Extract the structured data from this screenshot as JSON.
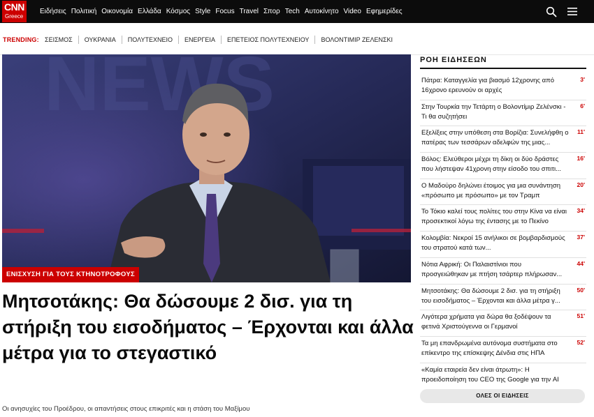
{
  "brand": {
    "logo_text": "CNN",
    "logo_sub": "Greece",
    "accent": "#cc0000",
    "nav_bg": "#0c0c0c"
  },
  "nav": {
    "links": [
      "Ειδήσεις",
      "Πολιτική",
      "Οικονομία",
      "Ελλάδα",
      "Κόσμος",
      "Style",
      "Focus",
      "Travel",
      "Σπορ",
      "Tech",
      "Αυτοκίνητο",
      "Video",
      "Εφημερίδες"
    ],
    "icons": [
      "search-icon",
      "menu-icon"
    ]
  },
  "trending": {
    "label": "TRENDING:",
    "items": [
      "ΣΕΙΣΜΟΣ",
      "ΟΥΚΡΑΝΙΑ",
      "ΠΟΛΥΤΕΧΝΕΙΟ",
      "ΕΝΕΡΓΕΙΑ",
      "ΕΠΕΤΕΙΟΣ ΠΟΛΥΤΕΧΝΕΙΟΥ",
      "ΒΟΛΟΝΤΙΜΙΡ ΖΕΛΕΝΣΚΙ"
    ]
  },
  "hero": {
    "tag": "ΕΝΙΣΧΥΣΗ ΓΙΑ ΤΟΥΣ ΚΤΗΝΟΤΡΟΦΟΥΣ",
    "headline": "Μητσοτάκης: Θα δώσουμε 2 δισ. για τη στήριξη του εισοδήματος – Έρχονται και άλλα μέτρα για το στεγαστικό",
    "subhead": "Οι ανησυχίες του Προέδρου, οι απαντήσεις στους επικριτές και η στάση του Μαξίμου"
  },
  "ticker": {
    "title": "ΡΟΗ ΕΙΔΗΣΕΩΝ",
    "items": [
      {
        "text": "Πάτρα: Καταγγελία για βιασμό 12χρονης από 16χρονο ερευνούν οι αρχές",
        "time": "3'"
      },
      {
        "text": "Στην Τουρκία την Τετάρτη ο Βολοντίμιρ Ζελένσκι - Τι θα συζητήσει",
        "time": "6'"
      },
      {
        "text": "Εξελίξεις στην υπόθεση στα Βορίζια: Συνελήφθη ο πατέρας των τεσσάρων αδελφών της μιας...",
        "time": "11'"
      },
      {
        "text": "Βόλος: Ελεύθεροι μέχρι τη δίκη οι δύο δράστες που λήστεψαν 41χρονη στην είσοδο του σπιτι...",
        "time": "16'"
      },
      {
        "text": "Ο Μαδούρο δηλώνει έτοιμος για μια συνάντηση «πρόσωπο με πρόσωπο» με τον Τραμπ",
        "time": "20'"
      },
      {
        "text": "Το Τόκιο καλεί τους πολίτες του στην Κίνα να είναι προσεκτικοί λόγω της έντασης με το Πεκίνο",
        "time": "34'"
      },
      {
        "text": "Κολομβία: Νεκροί 15 ανήλικοι σε βομβαρδισμούς του στρατού κατά των...",
        "time": "37'"
      },
      {
        "text": "Νότια Αφρική: Οι Παλαιστίνιοι που προσγειώθηκαν με πτήση τσάρτερ πλήρωσαν...",
        "time": "44'"
      },
      {
        "text": "Μητσοτάκης: Θα δώσουμε 2 δισ. για τη στήριξη του εισοδήματος – Έρχονται και άλλα μέτρα γ...",
        "time": "50'"
      },
      {
        "text": "Λιγότερα χρήματα για δώρα θα ξοδέψουν τα φετινά Χριστούγεννα οι Γερμανοί",
        "time": "51'"
      },
      {
        "text": "Τα μη επανδρωμένα αυτόνομα συστήματα στο επίκεντρο της επίσκεψης Δένδια στις ΗΠΑ",
        "time": "52'"
      },
      {
        "text": "«Καμία εταιρεία δεν είναι άτρωτη»: Η προειδοποίηση του CEO της Google για την AI",
        "time": ""
      }
    ],
    "more_label": "ΟΛΕΣ ΟΙ ΕΙΔΗΣΕΙΣ"
  }
}
